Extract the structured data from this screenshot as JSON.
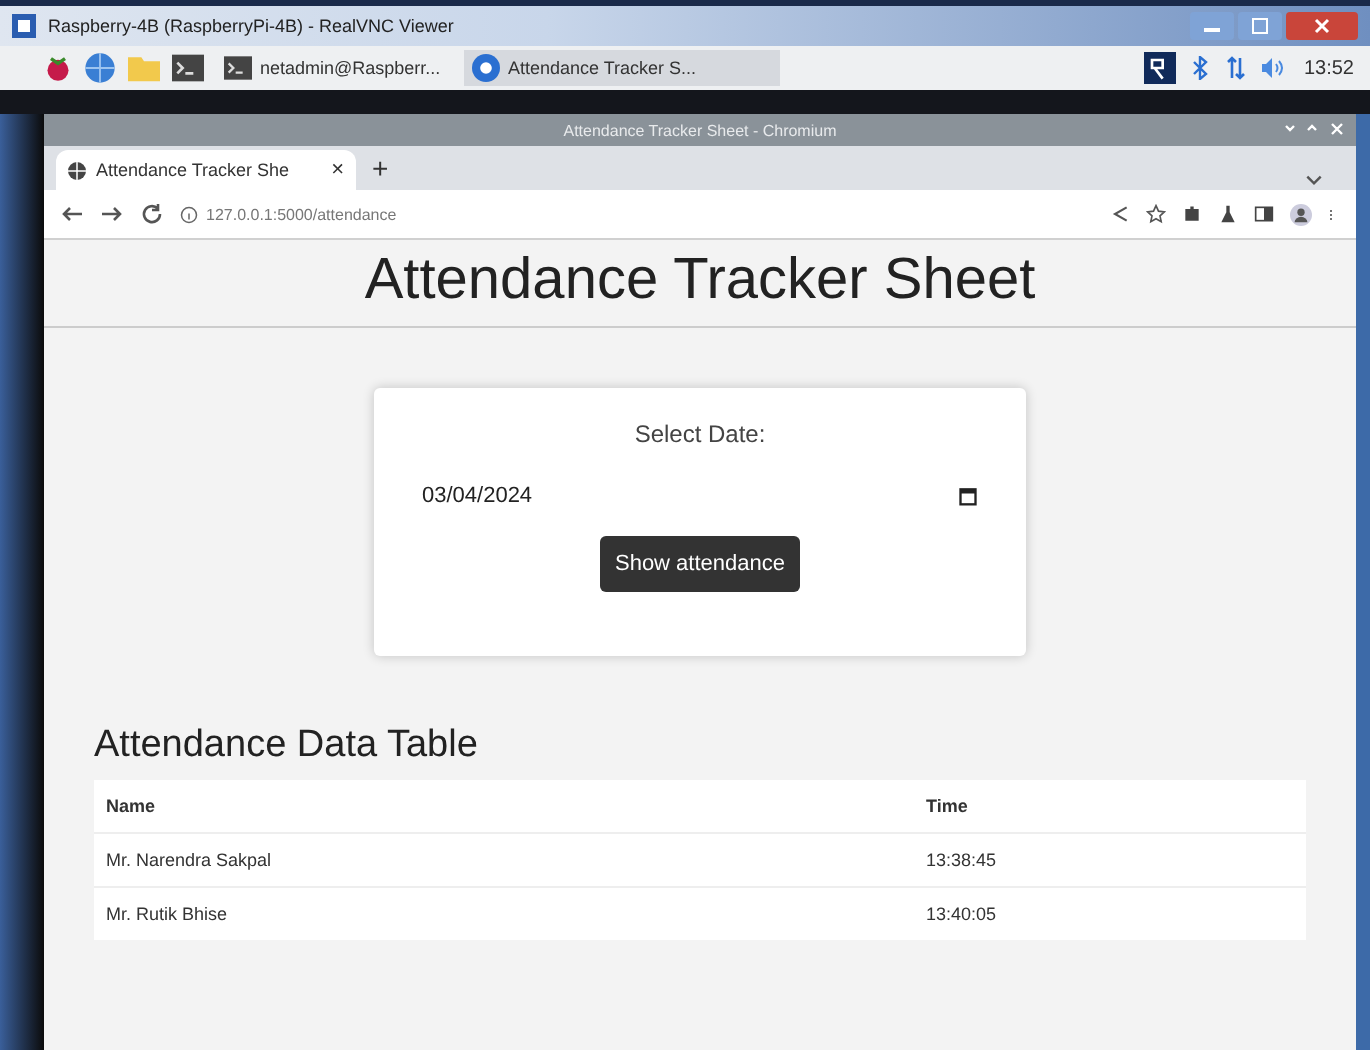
{
  "vnc_window": {
    "title": "Raspberry-4B (RaspberryPi-4B) - RealVNC Viewer"
  },
  "taskbar": {
    "tasks": [
      {
        "label": "netadmin@Raspberr...",
        "kind": "terminal",
        "selected": false
      },
      {
        "label": "Attendance Tracker S...",
        "kind": "browser",
        "selected": true
      }
    ],
    "clock": "13:52"
  },
  "browser": {
    "title": "Attendance Tracker Sheet - Chromium",
    "tab": {
      "label": "Attendance Tracker She",
      "close": "×"
    },
    "new_tab": "+",
    "url": "127.0.0.1:5000/attendance"
  },
  "page": {
    "heading": "Attendance Tracker Sheet",
    "form": {
      "label": "Select Date:",
      "date_value": "03/04/2024",
      "button": "Show attendance"
    },
    "table": {
      "title": "Attendance Data Table",
      "columns": [
        "Name",
        "Time"
      ],
      "rows": [
        [
          "Mr. Narendra Sakpal",
          "13:38:45"
        ],
        [
          "Mr. Rutik Bhise",
          "13:40:05"
        ]
      ]
    }
  }
}
